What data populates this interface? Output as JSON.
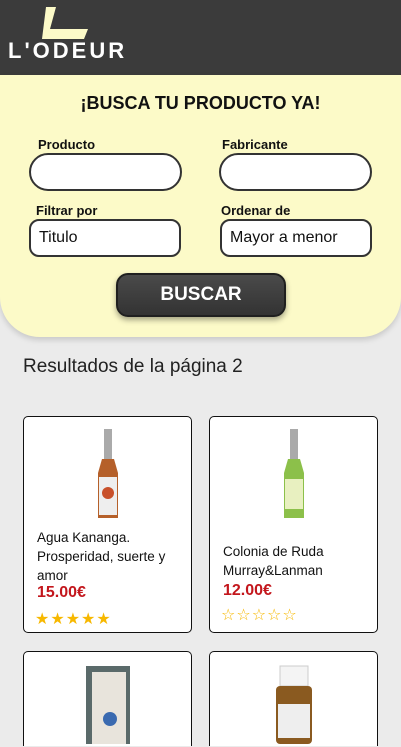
{
  "header": {
    "logo_text": "L'ODEUR"
  },
  "search": {
    "title": "¡BUSCA TU PRODUCTO YA!",
    "producto_label": "Producto",
    "producto_value": "",
    "fabricante_label": "Fabricante",
    "fabricante_value": "",
    "filtrar_label": "Filtrar por",
    "filtrar_value": "Titulo",
    "ordenar_label": "Ordenar de",
    "ordenar_value": "Mayor a menor",
    "button": "BUSCAR"
  },
  "results": {
    "heading": "Resultados de la página 2"
  },
  "products": [
    {
      "name": "Agua Kananga. Prosperidad, suerte y amor",
      "price": "15.00€",
      "stars": "★★★★★",
      "rating": 5
    },
    {
      "name": "Colonia de Ruda Murray&Lanman",
      "price": "12.00€",
      "stars": "☆☆☆☆☆",
      "rating": 0
    },
    {
      "name": "",
      "price": "",
      "stars": ""
    },
    {
      "name": "",
      "price": "",
      "stars": ""
    }
  ]
}
